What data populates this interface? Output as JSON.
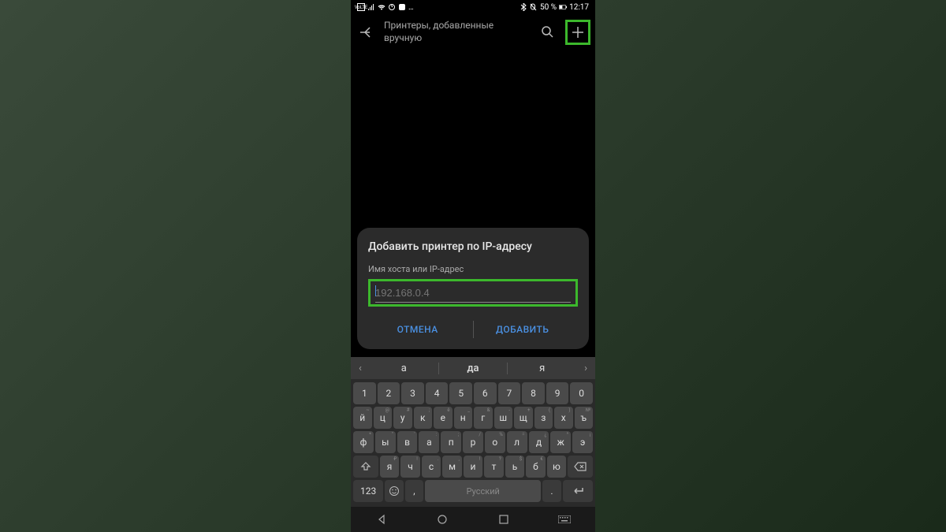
{
  "status": {
    "volte": "VoLTE",
    "battery_pct": "50 %",
    "time": "12:17"
  },
  "header": {
    "title": "Принтеры, добавленные вручную"
  },
  "dialog": {
    "title": "Добавить принтер по IP-адресу",
    "label": "Имя хоста или IP-адрес",
    "placeholder": "192.168.0.4",
    "cancel": "ОТМЕНА",
    "confirm": "ДОБАВИТЬ"
  },
  "suggestions": {
    "left": "а",
    "mid": "да",
    "right": "я"
  },
  "keyboard": {
    "row1": [
      {
        "main": "1",
        "sup": ""
      },
      {
        "main": "2",
        "sup": ""
      },
      {
        "main": "3",
        "sup": ""
      },
      {
        "main": "4",
        "sup": ""
      },
      {
        "main": "5",
        "sup": ""
      },
      {
        "main": "6",
        "sup": ""
      },
      {
        "main": "7",
        "sup": ""
      },
      {
        "main": "8",
        "sup": ""
      },
      {
        "main": "9",
        "sup": ""
      },
      {
        "main": "0",
        "sup": ""
      }
    ],
    "row2": [
      {
        "main": "й",
        "sup": "~"
      },
      {
        "main": "ц",
        "sup": "@"
      },
      {
        "main": "у",
        "sup": "#"
      },
      {
        "main": "к",
        "sup": ";"
      },
      {
        "main": "е",
        "sup": "ё"
      },
      {
        "main": "н",
        "sup": "_"
      },
      {
        "main": "г",
        "sup": "&"
      },
      {
        "main": "ш",
        "sup": "-"
      },
      {
        "main": "щ",
        "sup": "+"
      },
      {
        "main": "з",
        "sup": "("
      },
      {
        "main": "х",
        "sup": ")"
      },
      {
        "main": "ъ",
        "sup": "№"
      }
    ],
    "row3": [
      {
        "main": "ф",
        "sup": "*"
      },
      {
        "main": "ы",
        "sup": "\""
      },
      {
        "main": "в",
        "sup": "'"
      },
      {
        "main": "а",
        "sup": ":"
      },
      {
        "main": "п",
        "sup": ";"
      },
      {
        "main": "р",
        "sup": "/"
      },
      {
        "main": "о",
        "sup": "%"
      },
      {
        "main": "л",
        "sup": "="
      },
      {
        "main": "д",
        "sup": "¿"
      },
      {
        "main": "ж",
        "sup": "^"
      },
      {
        "main": "э",
        "sup": "¡"
      }
    ],
    "row4": [
      {
        "main": "я",
        "sup": "₽"
      },
      {
        "main": "ч",
        "sup": "!"
      },
      {
        "main": "с",
        "sup": "."
      },
      {
        "main": "м",
        "sup": ","
      },
      {
        "main": "и",
        "sup": "!"
      },
      {
        "main": "т",
        "sup": "?"
      },
      {
        "main": "ь",
        "sup": "$"
      },
      {
        "main": "б",
        "sup": "€"
      },
      {
        "main": "ю",
        "sup": ""
      }
    ],
    "numkey": "123",
    "space": "Русский",
    "period": "."
  }
}
